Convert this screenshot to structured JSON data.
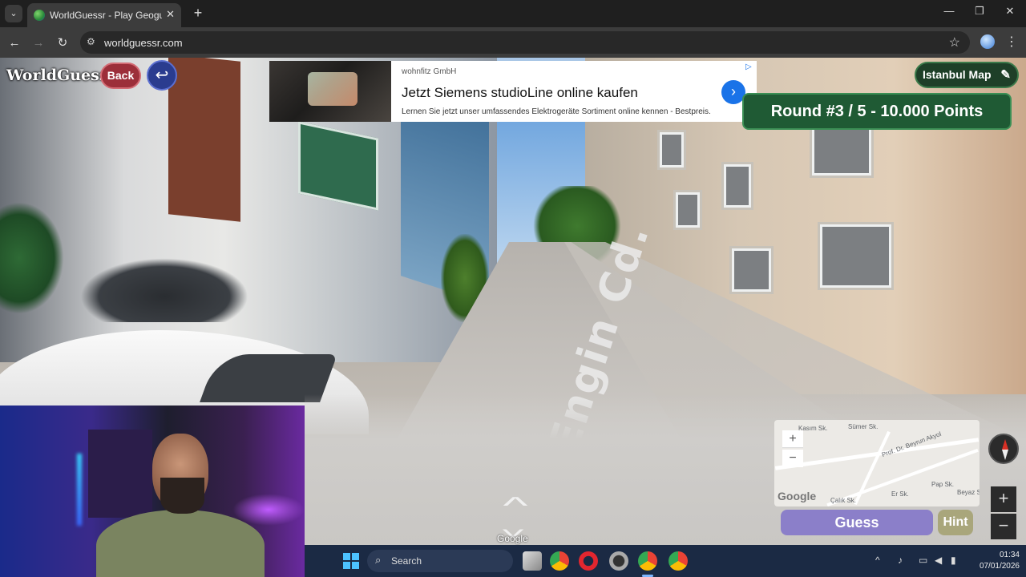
{
  "browser": {
    "tab_title": "WorldGuessr - Play Geoguessr Free",
    "tab_close": "✕",
    "new_tab": "+",
    "url": "worldguessr.com",
    "window_controls": [
      "—",
      "❐",
      "✕"
    ]
  },
  "game": {
    "logo": "WorldGuessr",
    "back_label": "Back",
    "map_name": "Istanbul Map",
    "round_text": "Round #3 / 5 - 10.000 Points",
    "guess_label": "Guess",
    "hint_label": "Hint",
    "street_label": "Engin Cd.",
    "google_logo": "Google"
  },
  "ad": {
    "advertiser": "wohnfitz GmbH",
    "headline": "Jetzt Siemens studioLine online kaufen",
    "body": "Lernen Sie jetzt unser umfassendes Elektrogeräte Sortiment online kennen - Bestpreis."
  },
  "minimap": {
    "labels": [
      "Kasım Sk.",
      "Sümer Sk.",
      "Prof. Dr. Beyrun Akyol",
      "Er Sk.",
      "Pap Sk.",
      "Beyaz Sk.",
      "Çalık Sk."
    ],
    "zoom_in": "+",
    "zoom_out": "−",
    "logo": "Google"
  },
  "streetview": {
    "zoom_in": "+",
    "zoom_out": "−"
  },
  "taskbar": {
    "search_placeholder": "Search",
    "time": "01:34",
    "date": "07/01/2026"
  },
  "colors": {
    "guess": "#8b7fc9",
    "hint": "#a9a67b",
    "round_banner": "#1f5a34",
    "back": "#9c2f3a",
    "undo": "#2a3c8f"
  }
}
